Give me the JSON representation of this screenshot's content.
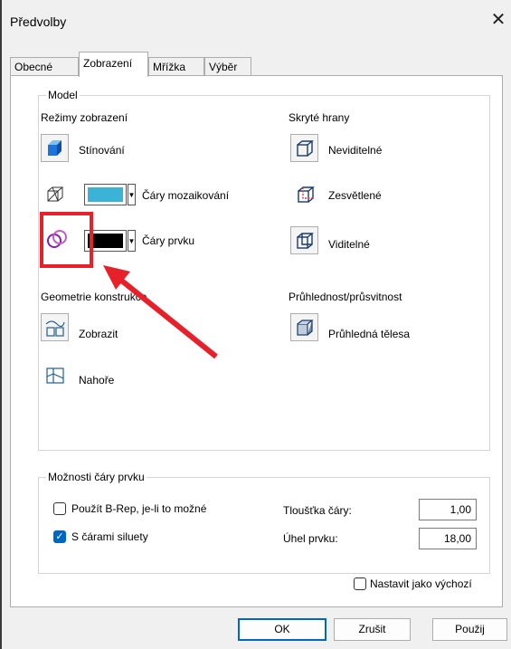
{
  "window": {
    "title": "Předvolby",
    "close_glyph": "✕"
  },
  "tabs": [
    {
      "label": "Obecné",
      "active": false
    },
    {
      "label": "Zobrazení",
      "active": true
    },
    {
      "label": "Mřížka",
      "active": false
    },
    {
      "label": "Výběr",
      "active": false
    }
  ],
  "model": {
    "legend": "Model",
    "modes_heading": "Režimy zobrazení",
    "shading_label": "Stínování",
    "mesh_lines_label": "Čáry mozaikování",
    "feature_lines_label": "Čáry prvku",
    "mesh_color": "#3bb3d6",
    "feature_color": "#000000",
    "hidden_edges_heading": "Skryté hrany",
    "invisible_label": "Neviditelné",
    "dimmed_label": "Zesvětlené",
    "visible_label": "Viditelné",
    "construction_heading": "Geometrie konstrukce",
    "show_label": "Zobrazit",
    "on_top_label": "Nahoře",
    "transparency_heading": "Průhlednost/průsvitnost",
    "transparent_bodies_label": "Průhledná tělesa"
  },
  "feature_options": {
    "legend": "Možnosti čáry prvku",
    "brep_label": "Použít B-Rep, je-li to možné",
    "brep_checked": false,
    "silhouette_label": "S čárami siluety",
    "silhouette_checked": true,
    "thickness_label": "Tloušťka čáry:",
    "thickness_value": "1,00",
    "angle_label": "Úhel prvku:",
    "angle_value": "18,00"
  },
  "set_default_label": "Nastavit jako výchozí",
  "set_default_checked": false,
  "buttons": {
    "ok": "OK",
    "cancel": "Zrušit",
    "apply": "Použij"
  },
  "annotation_color": "#e8202a"
}
